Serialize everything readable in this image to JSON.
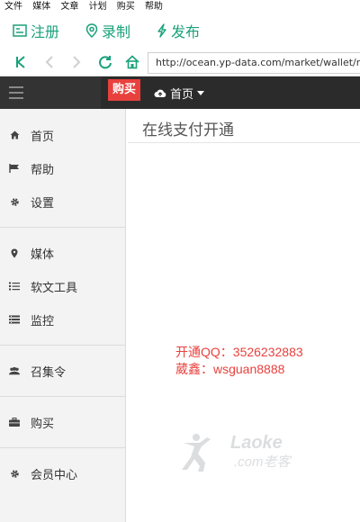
{
  "menubar": {
    "items": [
      "文件",
      "媒体",
      "文章",
      "计划",
      "购买",
      "帮助"
    ]
  },
  "toolbar": {
    "register_label": "注册",
    "record_label": "录制",
    "publish_label": "发布"
  },
  "nav": {
    "url": "http://ocean.yp-data.com/market/wallet/re"
  },
  "header": {
    "buy_tag": "购买",
    "home_tab": "首页"
  },
  "sidebar": {
    "items": [
      {
        "label": "首页",
        "icon": "home-icon"
      },
      {
        "label": "帮助",
        "icon": "flag-icon"
      },
      {
        "label": "设置",
        "icon": "gear-icon"
      },
      {
        "label": "媒体",
        "icon": "location-pin-icon"
      },
      {
        "label": "软文工具",
        "icon": "list-icon"
      },
      {
        "label": "监控",
        "icon": "monitor-icon"
      },
      {
        "label": "召集令",
        "icon": "users-icon"
      },
      {
        "label": "购买",
        "icon": "briefcase-icon"
      },
      {
        "label": "会员中心",
        "icon": "gear-icon"
      }
    ]
  },
  "main": {
    "title": "在线支付开通",
    "contact_qq": "开通QQ：3526232883",
    "contact_name": "葳鑫：wsguan8888"
  },
  "watermark": {
    "brand": "Laoke",
    "domain": ".com老客"
  },
  "colors": {
    "accent": "#1aa17a",
    "header_bg": "#2b2b2b",
    "buy_red": "#e8413d"
  }
}
